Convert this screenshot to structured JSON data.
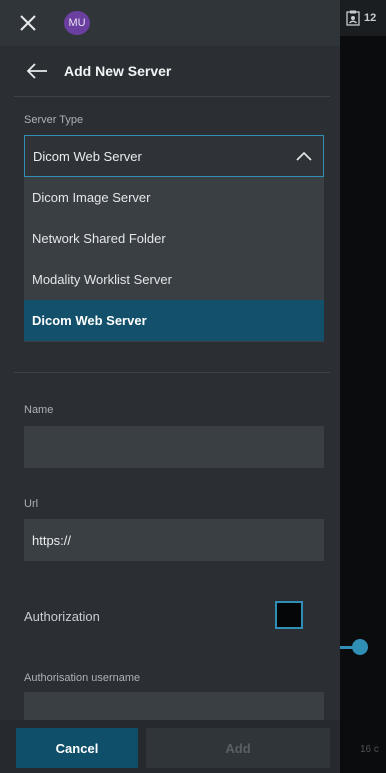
{
  "topbar": {
    "avatar_initials": "MU"
  },
  "header": {
    "title": "Add New Server"
  },
  "server_type": {
    "label": "Server Type",
    "selected_value": "Dicom Web Server",
    "options": [
      "Dicom Image Server",
      "Network Shared Folder",
      "Modality Worklist Server",
      "Dicom Web Server"
    ],
    "selected_index": 3
  },
  "form": {
    "name_label": "Name",
    "name_value": "",
    "url_label": "Url",
    "url_value": "https://",
    "authorization_label": "Authorization",
    "auth_username_label": "Authorisation username",
    "auth_username_value": ""
  },
  "footer": {
    "cancel_label": "Cancel",
    "add_label": "Add"
  },
  "right_panel": {
    "count": "12",
    "bottom_text": "16 c"
  },
  "colors": {
    "accent": "#2f8fb5",
    "selected_option_bg": "#12506b",
    "cancel_bg": "#0f4f6a",
    "avatar_bg": "#6b3fa0"
  },
  "icons": {
    "close": "close-icon",
    "back": "arrow-left-icon",
    "chevron": "chevron-up-icon",
    "clipboard": "clipboard-user-icon"
  }
}
